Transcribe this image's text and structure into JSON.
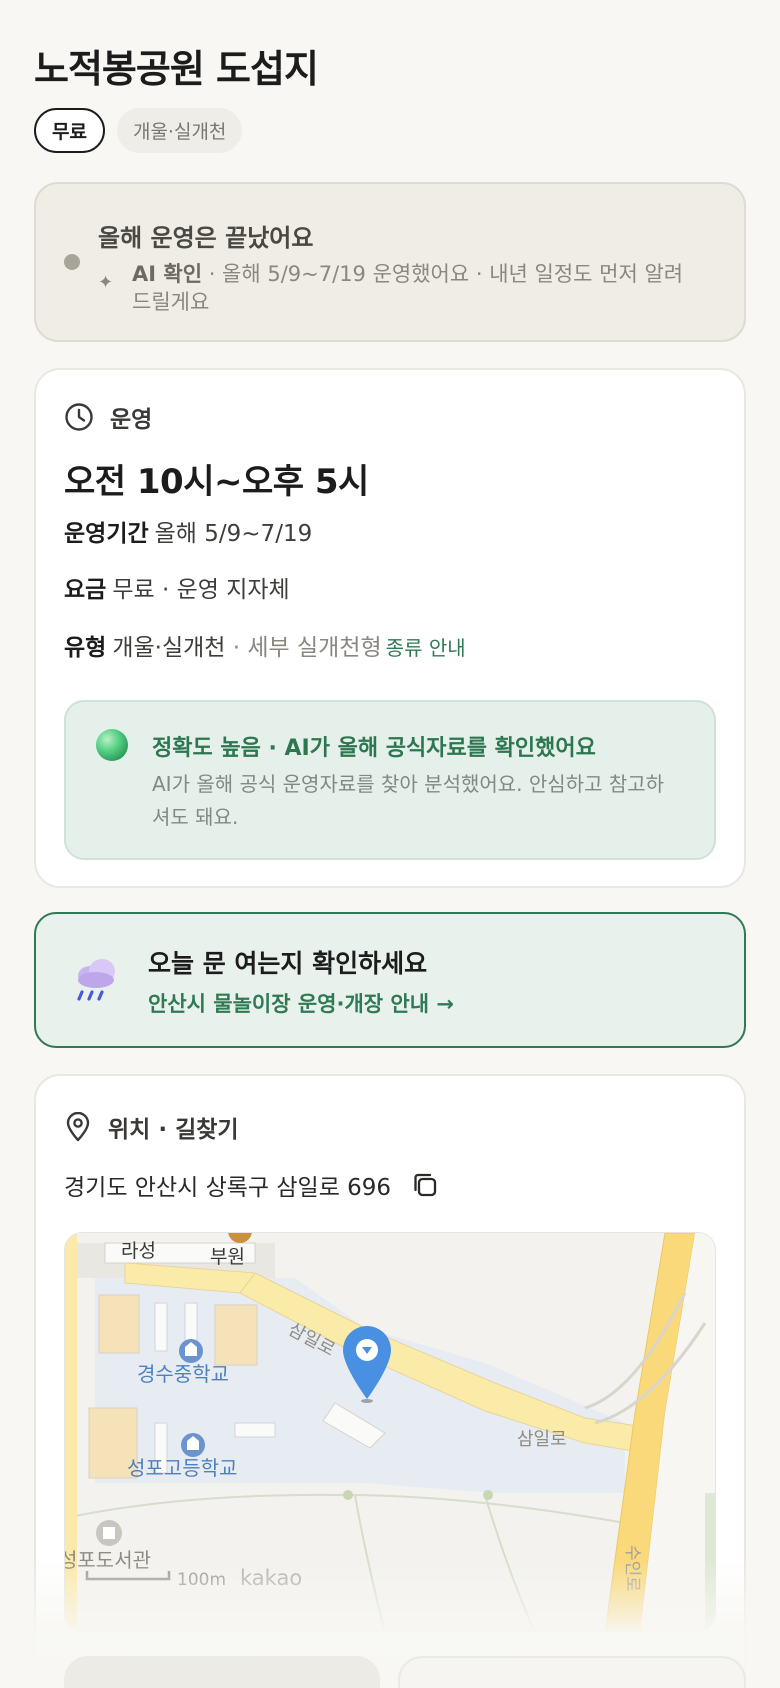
{
  "page": {
    "title": "노적봉공원 도섭지",
    "chips": [
      "무료",
      "개울·실개천"
    ]
  },
  "season_notice": {
    "heading": "올해 운영은 끝났어요",
    "ai_label": "AI 확인",
    "ai_text": " · 올해 5/9~7/19 운영했어요 · 내년 일정도 먼저 알려드릴게요"
  },
  "operation": {
    "section_label": "운영",
    "hours": "오전 10시~오후 5시",
    "period_key": "운영기간",
    "period_value": "올해 5/9~7/19",
    "fee_key": "요금",
    "fee_value": "무료 · 운영 지자체",
    "type_key": "유형",
    "type_value": "개울·실개천",
    "type_detail": " · 세부 실개천형",
    "type_link": "종류 안내",
    "accuracy_title": "정확도 높음 · AI가 올해 공식자료를 확인했어요",
    "accuracy_desc": "AI가 올해 공식 운영자료를 찾아 분석했어요. 안심하고 참고하셔도 돼요."
  },
  "check": {
    "heading": "오늘 문 여는지 확인하세요",
    "link": "안산시 물놀이장 운영·개장 안내 →"
  },
  "location": {
    "section_label": "위치 · 길찾기",
    "address": "경기도 안산시 상록구 삼일로 696",
    "map": {
      "labels": {
        "label_1": "라성",
        "label_2": "부원",
        "road_1": "삼일로",
        "road_2": "삼일로",
        "school_1": "경수중학교",
        "school_2": "성포고등학교",
        "library": "성포도서관",
        "road_3": "수인로"
      },
      "scale": "100m",
      "brand": "kakao"
    }
  },
  "colors": {
    "accent_green": "#2f7a54",
    "ended_card_bg": "#efede6",
    "map_pin": "#4a90e2"
  }
}
